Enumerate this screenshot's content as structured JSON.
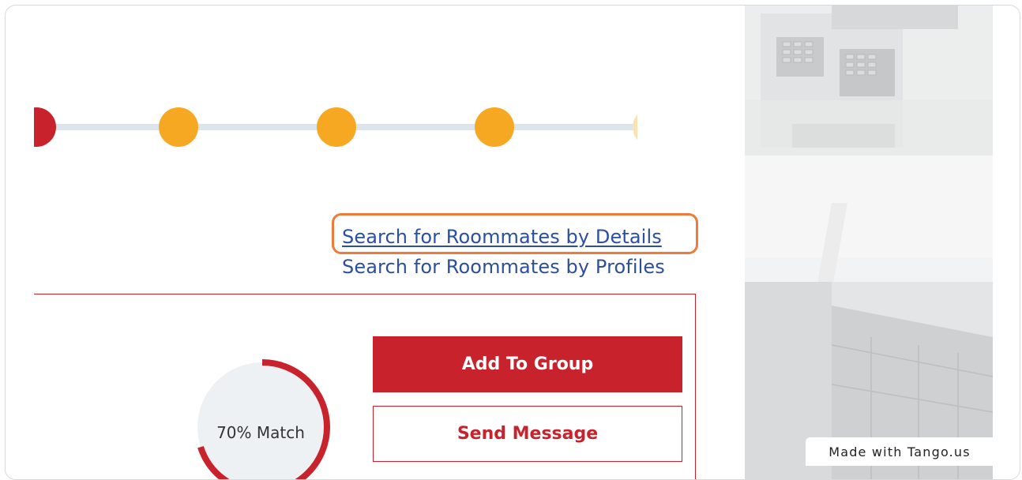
{
  "links": {
    "search_by_details": "Search for Roommates by Details",
    "search_by_profiles": "Search for Roommates by Profiles"
  },
  "match": {
    "label": "70% Match",
    "percent": 70
  },
  "buttons": {
    "add_to_group": "Add To Group",
    "send_message": "Send Message"
  },
  "stepper": {
    "steps": [
      {
        "state": "current",
        "color": "#c8232c"
      },
      {
        "state": "pending",
        "color": "#f7a823"
      },
      {
        "state": "pending",
        "color": "#f7a823"
      },
      {
        "state": "pending",
        "color": "#f7a823"
      },
      {
        "state": "faded",
        "color": "#fbe2b4"
      }
    ]
  },
  "watermark": {
    "text": "Made with Tango.us"
  },
  "colors": {
    "brand_red": "#c8232c",
    "step_orange": "#f7a823",
    "link_blue": "#2a4fa8",
    "highlight_orange": "#f07a39"
  }
}
